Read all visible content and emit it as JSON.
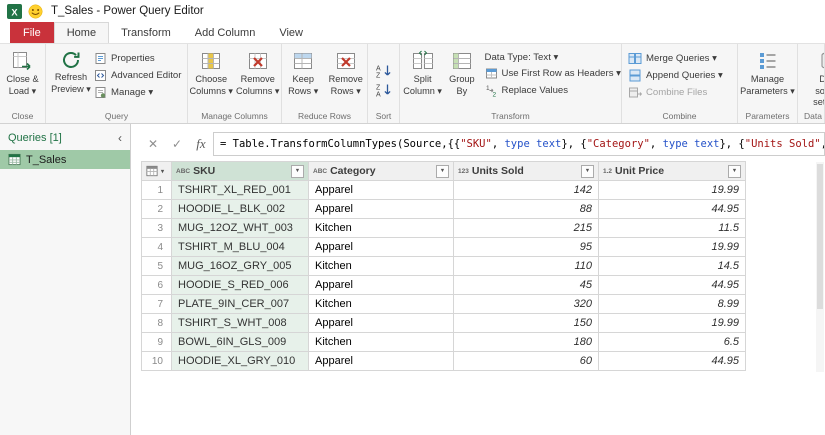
{
  "titlebar": {
    "title": "T_Sales - Power Query Editor"
  },
  "tabs": {
    "file": "File",
    "home": "Home",
    "transform": "Transform",
    "add_column": "Add Column",
    "view": "View"
  },
  "ribbon": {
    "close": {
      "group_label": "Close",
      "close_load": "Close &\nLoad ▾"
    },
    "query": {
      "group_label": "Query",
      "refresh": "Refresh\nPreview ▾",
      "properties": "Properties",
      "advanced_editor": "Advanced Editor",
      "manage": "Manage ▾"
    },
    "manage_columns": {
      "group_label": "Manage Columns",
      "choose_columns": "Choose\nColumns ▾",
      "remove_columns": "Remove\nColumns ▾"
    },
    "reduce_rows": {
      "group_label": "Reduce Rows",
      "keep_rows": "Keep\nRows ▾",
      "remove_rows": "Remove\nRows ▾"
    },
    "sort": {
      "group_label": "Sort"
    },
    "transform": {
      "group_label": "Transform",
      "split_column": "Split\nColumn ▾",
      "group_by": "Group\nBy",
      "data_type": "Data Type: Text ▾",
      "use_first_row": "Use First Row as Headers ▾",
      "replace_values": "Replace Values"
    },
    "combine": {
      "group_label": "Combine",
      "merge_queries": "Merge Queries ▾",
      "append_queries": "Append Queries ▾",
      "combine_files": "Combine Files"
    },
    "parameters": {
      "group_label": "Parameters",
      "manage_parameters": "Manage\nParameters ▾"
    },
    "data_sources": {
      "group_label": "Data sources",
      "data_source_settings": "Data\nsource settings"
    }
  },
  "queries_pane": {
    "header": "Queries [1]",
    "collapse_glyph": "‹",
    "items": [
      {
        "name": "T_Sales",
        "selected": true
      }
    ]
  },
  "formula_bar": {
    "cancel_glyph": "✕",
    "check_glyph": "✓",
    "fx_label": "fx",
    "parts": [
      {
        "type": "plain",
        "text": "= Table.TransformColumnTypes(Source,{{"
      },
      {
        "type": "string",
        "text": "\"SKU\""
      },
      {
        "type": "plain",
        "text": ", "
      },
      {
        "type": "keyword",
        "text": "type text"
      },
      {
        "type": "plain",
        "text": "}, {"
      },
      {
        "type": "string",
        "text": "\"Category\""
      },
      {
        "type": "plain",
        "text": ", "
      },
      {
        "type": "keyword",
        "text": "type text"
      },
      {
        "type": "plain",
        "text": "}, {"
      },
      {
        "type": "string",
        "text": "\"Units Sold\""
      },
      {
        "type": "plain",
        "text": ","
      }
    ]
  },
  "table": {
    "filter_glyph": "▼",
    "corner_glyph": "▾",
    "columns": [
      {
        "type_icon": "ABC",
        "name": "SKU",
        "selected": true,
        "align": "left"
      },
      {
        "type_icon": "ABC",
        "name": "Category",
        "selected": false,
        "align": "left"
      },
      {
        "type_icon": "123",
        "name": "Units Sold",
        "selected": false,
        "align": "right"
      },
      {
        "type_icon": "1.2",
        "name": "Unit Price",
        "selected": false,
        "align": "right"
      }
    ],
    "rows": [
      [
        "TSHIRT_XL_RED_001",
        "Apparel",
        "142",
        "19.99"
      ],
      [
        "HOODIE_L_BLK_002",
        "Apparel",
        "88",
        "44.95"
      ],
      [
        "MUG_12OZ_WHT_003",
        "Kitchen",
        "215",
        "11.5"
      ],
      [
        "TSHIRT_M_BLU_004",
        "Apparel",
        "95",
        "19.99"
      ],
      [
        "MUG_16OZ_GRY_005",
        "Kitchen",
        "110",
        "14.5"
      ],
      [
        "HOODIE_S_RED_006",
        "Apparel",
        "45",
        "44.95"
      ],
      [
        "PLATE_9IN_CER_007",
        "Kitchen",
        "320",
        "8.99"
      ],
      [
        "TSHIRT_S_WHT_008",
        "Apparel",
        "150",
        "19.99"
      ],
      [
        "BOWL_6IN_GLS_009",
        "Kitchen",
        "180",
        "6.5"
      ],
      [
        "HOODIE_XL_GRY_010",
        "Apparel",
        "60",
        "44.95"
      ]
    ]
  },
  "colors": {
    "file_tab_red": "#c9323b",
    "excel_green": "#217346",
    "selected_query_bg": "#9fc9a7",
    "selected_column_header_bg": "#cfe2d5",
    "selected_column_cell_bg": "#e7f1ea",
    "formula_string": "#a31515",
    "formula_keyword": "#2451c8"
  }
}
